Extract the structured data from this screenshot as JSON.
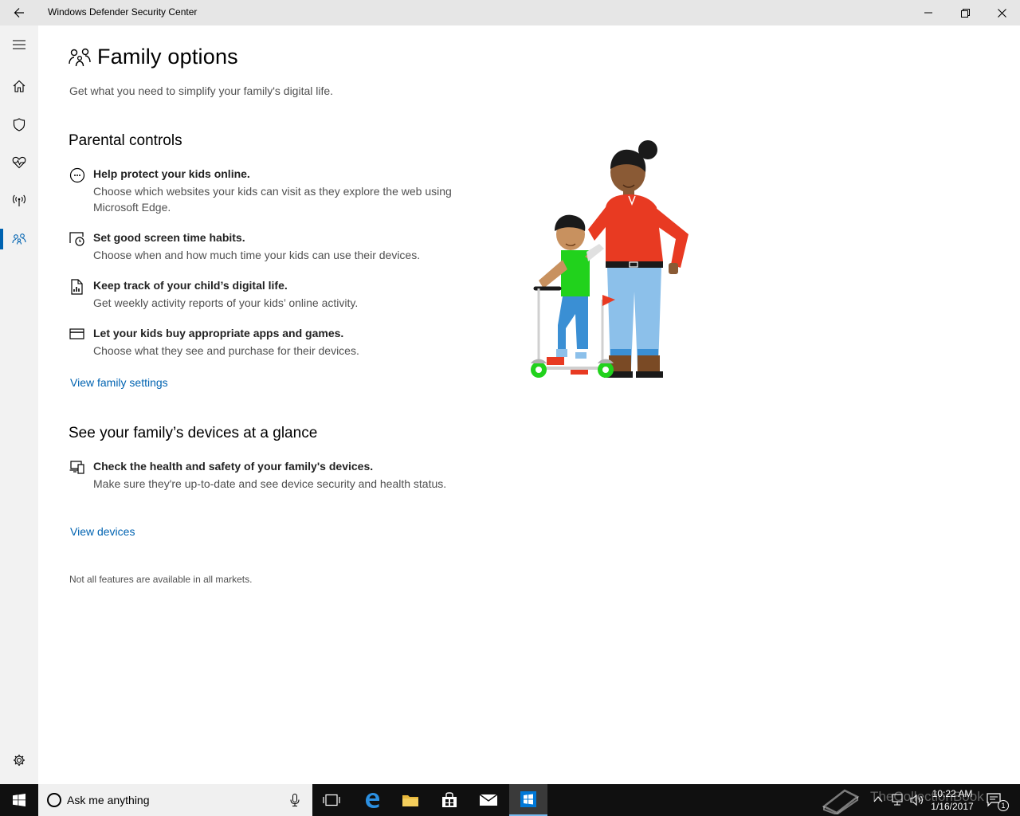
{
  "window": {
    "title": "Windows Defender Security Center"
  },
  "page": {
    "title": "Family options",
    "subtitle": "Get what you need to simplify your family's digital life."
  },
  "parental": {
    "heading": "Parental controls",
    "items": [
      {
        "title": "Help protect your kids online.",
        "desc": "Choose which websites your kids can visit as they explore the web using Microsoft Edge.",
        "icon": "web-filter-icon"
      },
      {
        "title": "Set good screen time habits.",
        "desc": "Choose when and how much time your kids can use their devices.",
        "icon": "screen-time-icon"
      },
      {
        "title": "Keep track of your child’s digital life.",
        "desc": "Get weekly activity reports of your kids’ online activity.",
        "icon": "activity-report-icon"
      },
      {
        "title": "Let your kids buy appropriate apps and games.",
        "desc": "Choose what they see and purchase for their devices.",
        "icon": "wallet-card-icon"
      }
    ],
    "link": "View family settings"
  },
  "devices": {
    "heading": "See your family’s devices at a glance",
    "items": [
      {
        "title": "Check the health and safety of your family's devices.",
        "desc": "Make sure they're up-to-date and see device security and health status.",
        "icon": "devices-icon"
      }
    ],
    "link": "View devices"
  },
  "footnote": "Not all features are available in all markets.",
  "taskbar": {
    "search_placeholder": "Ask me anything",
    "time": "10:22 AM",
    "date": "1/16/2017",
    "notification_count": "1",
    "watermark": "TheCollectionBook"
  },
  "colors": {
    "accent": "#0063b1",
    "titlebar": "#e6e6e6",
    "nav": "#f2f2f2",
    "taskbar": "#101010"
  }
}
